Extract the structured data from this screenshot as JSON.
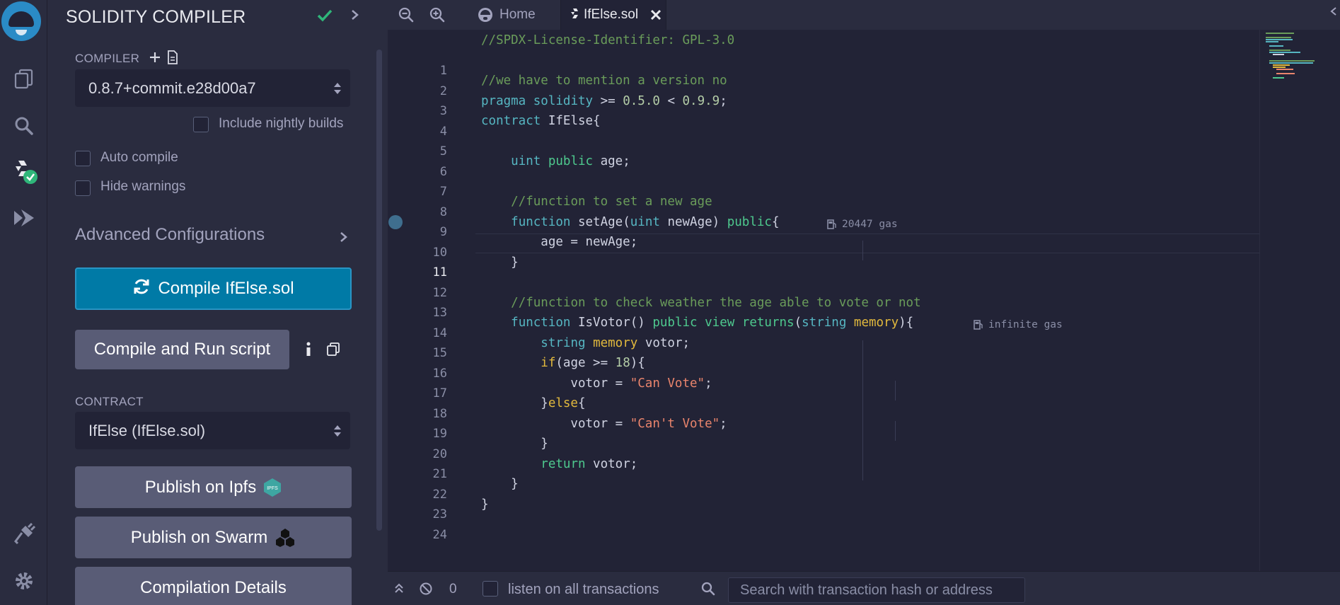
{
  "sidebar": {
    "icons": [
      "remix-logo-icon",
      "file-explorer-icon",
      "search-icon",
      "solidity-compiler-icon",
      "deploy-run-icon",
      "plugin-manager-icon",
      "settings-icon"
    ]
  },
  "panel": {
    "title": "SOLIDITY COMPILER",
    "compiler_label": "COMPILER",
    "compiler_version": "0.8.7+commit.e28d00a7",
    "nightly_label": "Include nightly builds",
    "auto_compile_label": "Auto compile",
    "hide_warnings_label": "Hide warnings",
    "advanced_label": "Advanced Configurations",
    "compile_button": "Compile IfElse.sol",
    "compile_run_button": "Compile and Run script",
    "contract_label": "CONTRACT",
    "contract_value": "IfElse (IfElse.sol)",
    "publish_ipfs": "Publish on Ipfs",
    "ipfs_badge": "IPFS",
    "publish_swarm": "Publish on Swarm",
    "compilation_details": "Compilation Details"
  },
  "editor": {
    "tabs": [
      {
        "label": "Home"
      },
      {
        "label": "IfElse.sol"
      }
    ],
    "active_line": 11,
    "line_numbers": [
      "1",
      "2",
      "3",
      "4",
      "5",
      "6",
      "7",
      "8",
      "9",
      "10",
      "11",
      "12",
      "13",
      "14",
      "15",
      "16",
      "17",
      "18",
      "19",
      "20",
      "21",
      "22",
      "23",
      "24"
    ],
    "lines": [
      "//SPDX-License-Identifier: GPL-3.0",
      "",
      "//we have to mention a version no",
      "pragma solidity >= 0.5.0 < 0.9.9;",
      "contract IfElse{",
      "",
      "    uint public age;",
      "",
      "    //function to set a new age",
      "    function setAge(uint newAge) public{",
      "        age = newAge;",
      "    }",
      "",
      "    //function to check weather the age able to vote or not",
      "    function IsVotor() public view returns(string memory){",
      "        string memory votor;",
      "        if(age >= 18){",
      "            votor = \"Can Vote\";",
      "        }else{",
      "            votor = \"Can't Vote\";",
      "        }",
      "        return votor;",
      "    }",
      "}"
    ],
    "gas_line10": "20447 gas",
    "gas_line15": "infinite gas"
  },
  "terminal": {
    "count": "0",
    "listen_label": "listen on all transactions",
    "search_placeholder": "Search with transaction hash or address"
  },
  "colors": {
    "accent": "#007aa6",
    "success": "#4ec98e",
    "background": "#222336",
    "panel": "#2a2c3f"
  }
}
